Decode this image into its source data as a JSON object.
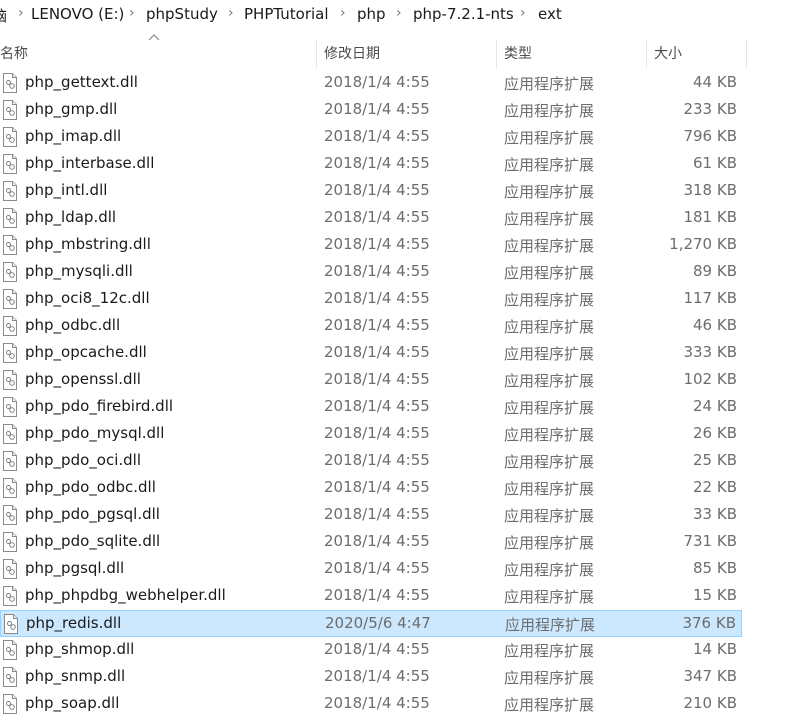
{
  "breadcrumb": {
    "parts": [
      "脑",
      "LENOVO (E:)",
      "phpStudy",
      "PHPTutorial",
      "php",
      "php-7.2.1-nts",
      "ext"
    ]
  },
  "columns": {
    "name": "名称",
    "date": "修改日期",
    "type": "类型",
    "size": "大小"
  },
  "icons": {
    "file": "dll-file-icon",
    "sort": "sort-ascending-icon",
    "separator": "chevron-right-icon"
  },
  "colors": {
    "selection_bg": "#cce8ff",
    "selection_border": "#99d1ff"
  },
  "files": [
    {
      "name": "php_gettext.dll",
      "date": "2018/1/4 4:55",
      "type": "应用程序扩展",
      "size": "44 KB"
    },
    {
      "name": "php_gmp.dll",
      "date": "2018/1/4 4:55",
      "type": "应用程序扩展",
      "size": "233 KB"
    },
    {
      "name": "php_imap.dll",
      "date": "2018/1/4 4:55",
      "type": "应用程序扩展",
      "size": "796 KB"
    },
    {
      "name": "php_interbase.dll",
      "date": "2018/1/4 4:55",
      "type": "应用程序扩展",
      "size": "61 KB"
    },
    {
      "name": "php_intl.dll",
      "date": "2018/1/4 4:55",
      "type": "应用程序扩展",
      "size": "318 KB"
    },
    {
      "name": "php_ldap.dll",
      "date": "2018/1/4 4:55",
      "type": "应用程序扩展",
      "size": "181 KB"
    },
    {
      "name": "php_mbstring.dll",
      "date": "2018/1/4 4:55",
      "type": "应用程序扩展",
      "size": "1,270 KB"
    },
    {
      "name": "php_mysqli.dll",
      "date": "2018/1/4 4:55",
      "type": "应用程序扩展",
      "size": "89 KB"
    },
    {
      "name": "php_oci8_12c.dll",
      "date": "2018/1/4 4:55",
      "type": "应用程序扩展",
      "size": "117 KB"
    },
    {
      "name": "php_odbc.dll",
      "date": "2018/1/4 4:55",
      "type": "应用程序扩展",
      "size": "46 KB"
    },
    {
      "name": "php_opcache.dll",
      "date": "2018/1/4 4:55",
      "type": "应用程序扩展",
      "size": "333 KB"
    },
    {
      "name": "php_openssl.dll",
      "date": "2018/1/4 4:55",
      "type": "应用程序扩展",
      "size": "102 KB"
    },
    {
      "name": "php_pdo_firebird.dll",
      "date": "2018/1/4 4:55",
      "type": "应用程序扩展",
      "size": "24 KB"
    },
    {
      "name": "php_pdo_mysql.dll",
      "date": "2018/1/4 4:55",
      "type": "应用程序扩展",
      "size": "26 KB"
    },
    {
      "name": "php_pdo_oci.dll",
      "date": "2018/1/4 4:55",
      "type": "应用程序扩展",
      "size": "25 KB"
    },
    {
      "name": "php_pdo_odbc.dll",
      "date": "2018/1/4 4:55",
      "type": "应用程序扩展",
      "size": "22 KB"
    },
    {
      "name": "php_pdo_pgsql.dll",
      "date": "2018/1/4 4:55",
      "type": "应用程序扩展",
      "size": "33 KB"
    },
    {
      "name": "php_pdo_sqlite.dll",
      "date": "2018/1/4 4:55",
      "type": "应用程序扩展",
      "size": "731 KB"
    },
    {
      "name": "php_pgsql.dll",
      "date": "2018/1/4 4:55",
      "type": "应用程序扩展",
      "size": "85 KB"
    },
    {
      "name": "php_phpdbg_webhelper.dll",
      "date": "2018/1/4 4:55",
      "type": "应用程序扩展",
      "size": "15 KB"
    },
    {
      "name": "php_redis.dll",
      "date": "2020/5/6 4:47",
      "type": "应用程序扩展",
      "size": "376 KB",
      "selected": true
    },
    {
      "name": "php_shmop.dll",
      "date": "2018/1/4 4:55",
      "type": "应用程序扩展",
      "size": "14 KB"
    },
    {
      "name": "php_snmp.dll",
      "date": "2018/1/4 4:55",
      "type": "应用程序扩展",
      "size": "347 KB"
    },
    {
      "name": "php_soap.dll",
      "date": "2018/1/4 4:55",
      "type": "应用程序扩展",
      "size": "210 KB"
    }
  ]
}
